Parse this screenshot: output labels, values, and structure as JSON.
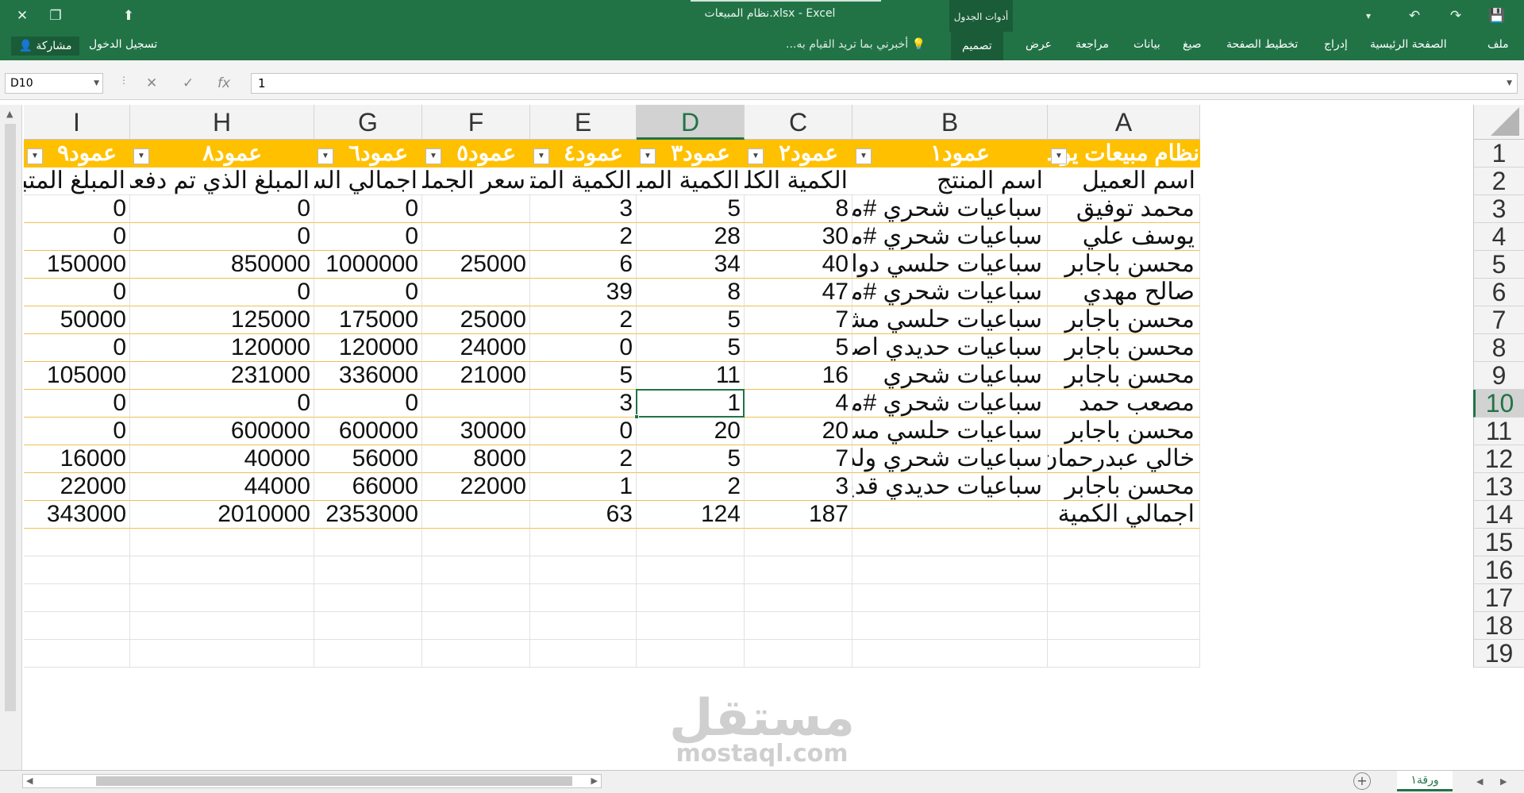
{
  "window": {
    "title": "نظام المبيعات.xlsx - Excel",
    "tools_label": "أدوات الجدول"
  },
  "ribbon": {
    "tabs": [
      "ملف",
      "الصفحة الرئيسية",
      "إدراج",
      "تخطيط الصفحة",
      "صيغ",
      "بيانات",
      "مراجعة",
      "عرض",
      "تصميم"
    ],
    "tell_me": "أخبرني بما تريد القيام به...",
    "signin": "تسجيل الدخول",
    "share": "مشاركة"
  },
  "formula_bar": {
    "name_box": "D10",
    "value": "1",
    "fx": "fx"
  },
  "columns": [
    "A",
    "B",
    "C",
    "D",
    "E",
    "F",
    "G",
    "H",
    "I"
  ],
  "rows": [
    "1",
    "2",
    "3",
    "4",
    "5",
    "6",
    "7",
    "8",
    "9",
    "10",
    "11",
    "12",
    "13",
    "14",
    "15",
    "16",
    "17",
    "18",
    "19"
  ],
  "table": {
    "headers": [
      "نظام مبيعات يومية",
      "عمود١",
      "عمود٢",
      "عمود٣",
      "عمود٤",
      "عمود٥",
      "عمود٦",
      "عمود٨",
      "عمود٩"
    ],
    "subheaders": [
      "اسم العميل",
      "اسم المنتج",
      "الكمية الكلية",
      "الكمية المباعة",
      "الكمية المتبقية",
      "سعر الجملة",
      "اجمالي السعر",
      "المبلغ الذي تم دفعه",
      "المبلغ المتبقي"
    ],
    "rows": [
      [
        "محمد توفيق",
        "سباعيات شحري  #مسدد",
        "8",
        "5",
        "3",
        "",
        "0",
        "0",
        "0"
      ],
      [
        "يوسف علي",
        "سباعيات شحري #مسدد",
        "30",
        "28",
        "2",
        "",
        "0",
        "0",
        "0"
      ],
      [
        "محسن باجابر",
        "سباعيات حلسي دواير",
        "40",
        "34",
        "6",
        "25000",
        "1000000",
        "850000",
        "150000"
      ],
      [
        "صالح مهدي",
        "سباعيات شحري #مسدد",
        "47",
        "8",
        "39",
        "",
        "0",
        "0",
        "0"
      ],
      [
        "محسن باجابر",
        "سباعيات حلسي مشكل",
        "7",
        "5",
        "2",
        "25000",
        "175000",
        "125000",
        "50000"
      ],
      [
        "محسن باجابر",
        "سباعيات حديدي اصلي",
        "5",
        "5",
        "0",
        "24000",
        "120000",
        "120000",
        "0"
      ],
      [
        "محسن باجابر",
        "سباعيات شحري",
        "16",
        "11",
        "5",
        "21000",
        "336000",
        "231000",
        "105000"
      ],
      [
        "مصعب حمد",
        "سباعيات شحري #مسدد",
        "4",
        "1",
        "3",
        "",
        "0",
        "0",
        "0"
      ],
      [
        "محسن باجابر",
        "سباعيات حلسي مسجات",
        "20",
        "20",
        "0",
        "30000",
        "600000",
        "600000",
        "0"
      ],
      [
        "خالي عبدرحمان",
        "سباعيات شحري ولدي",
        "7",
        "5",
        "2",
        "8000",
        "56000",
        "40000",
        "16000"
      ],
      [
        "محسن باجابر",
        "سباعيات حديدي قديم",
        "3",
        "2",
        "1",
        "22000",
        "66000",
        "44000",
        "22000"
      ]
    ],
    "totals": [
      "اجمالي الكمية",
      "",
      "187",
      "124",
      "63",
      "",
      "2353000",
      "2010000",
      "343000"
    ]
  },
  "sheet_tab": "ورقة١",
  "watermark": {
    "arabic": "مستقل",
    "latin": "mostaql.com"
  },
  "colors": {
    "excel_green": "#217346",
    "header_gold": "#ffc000"
  }
}
